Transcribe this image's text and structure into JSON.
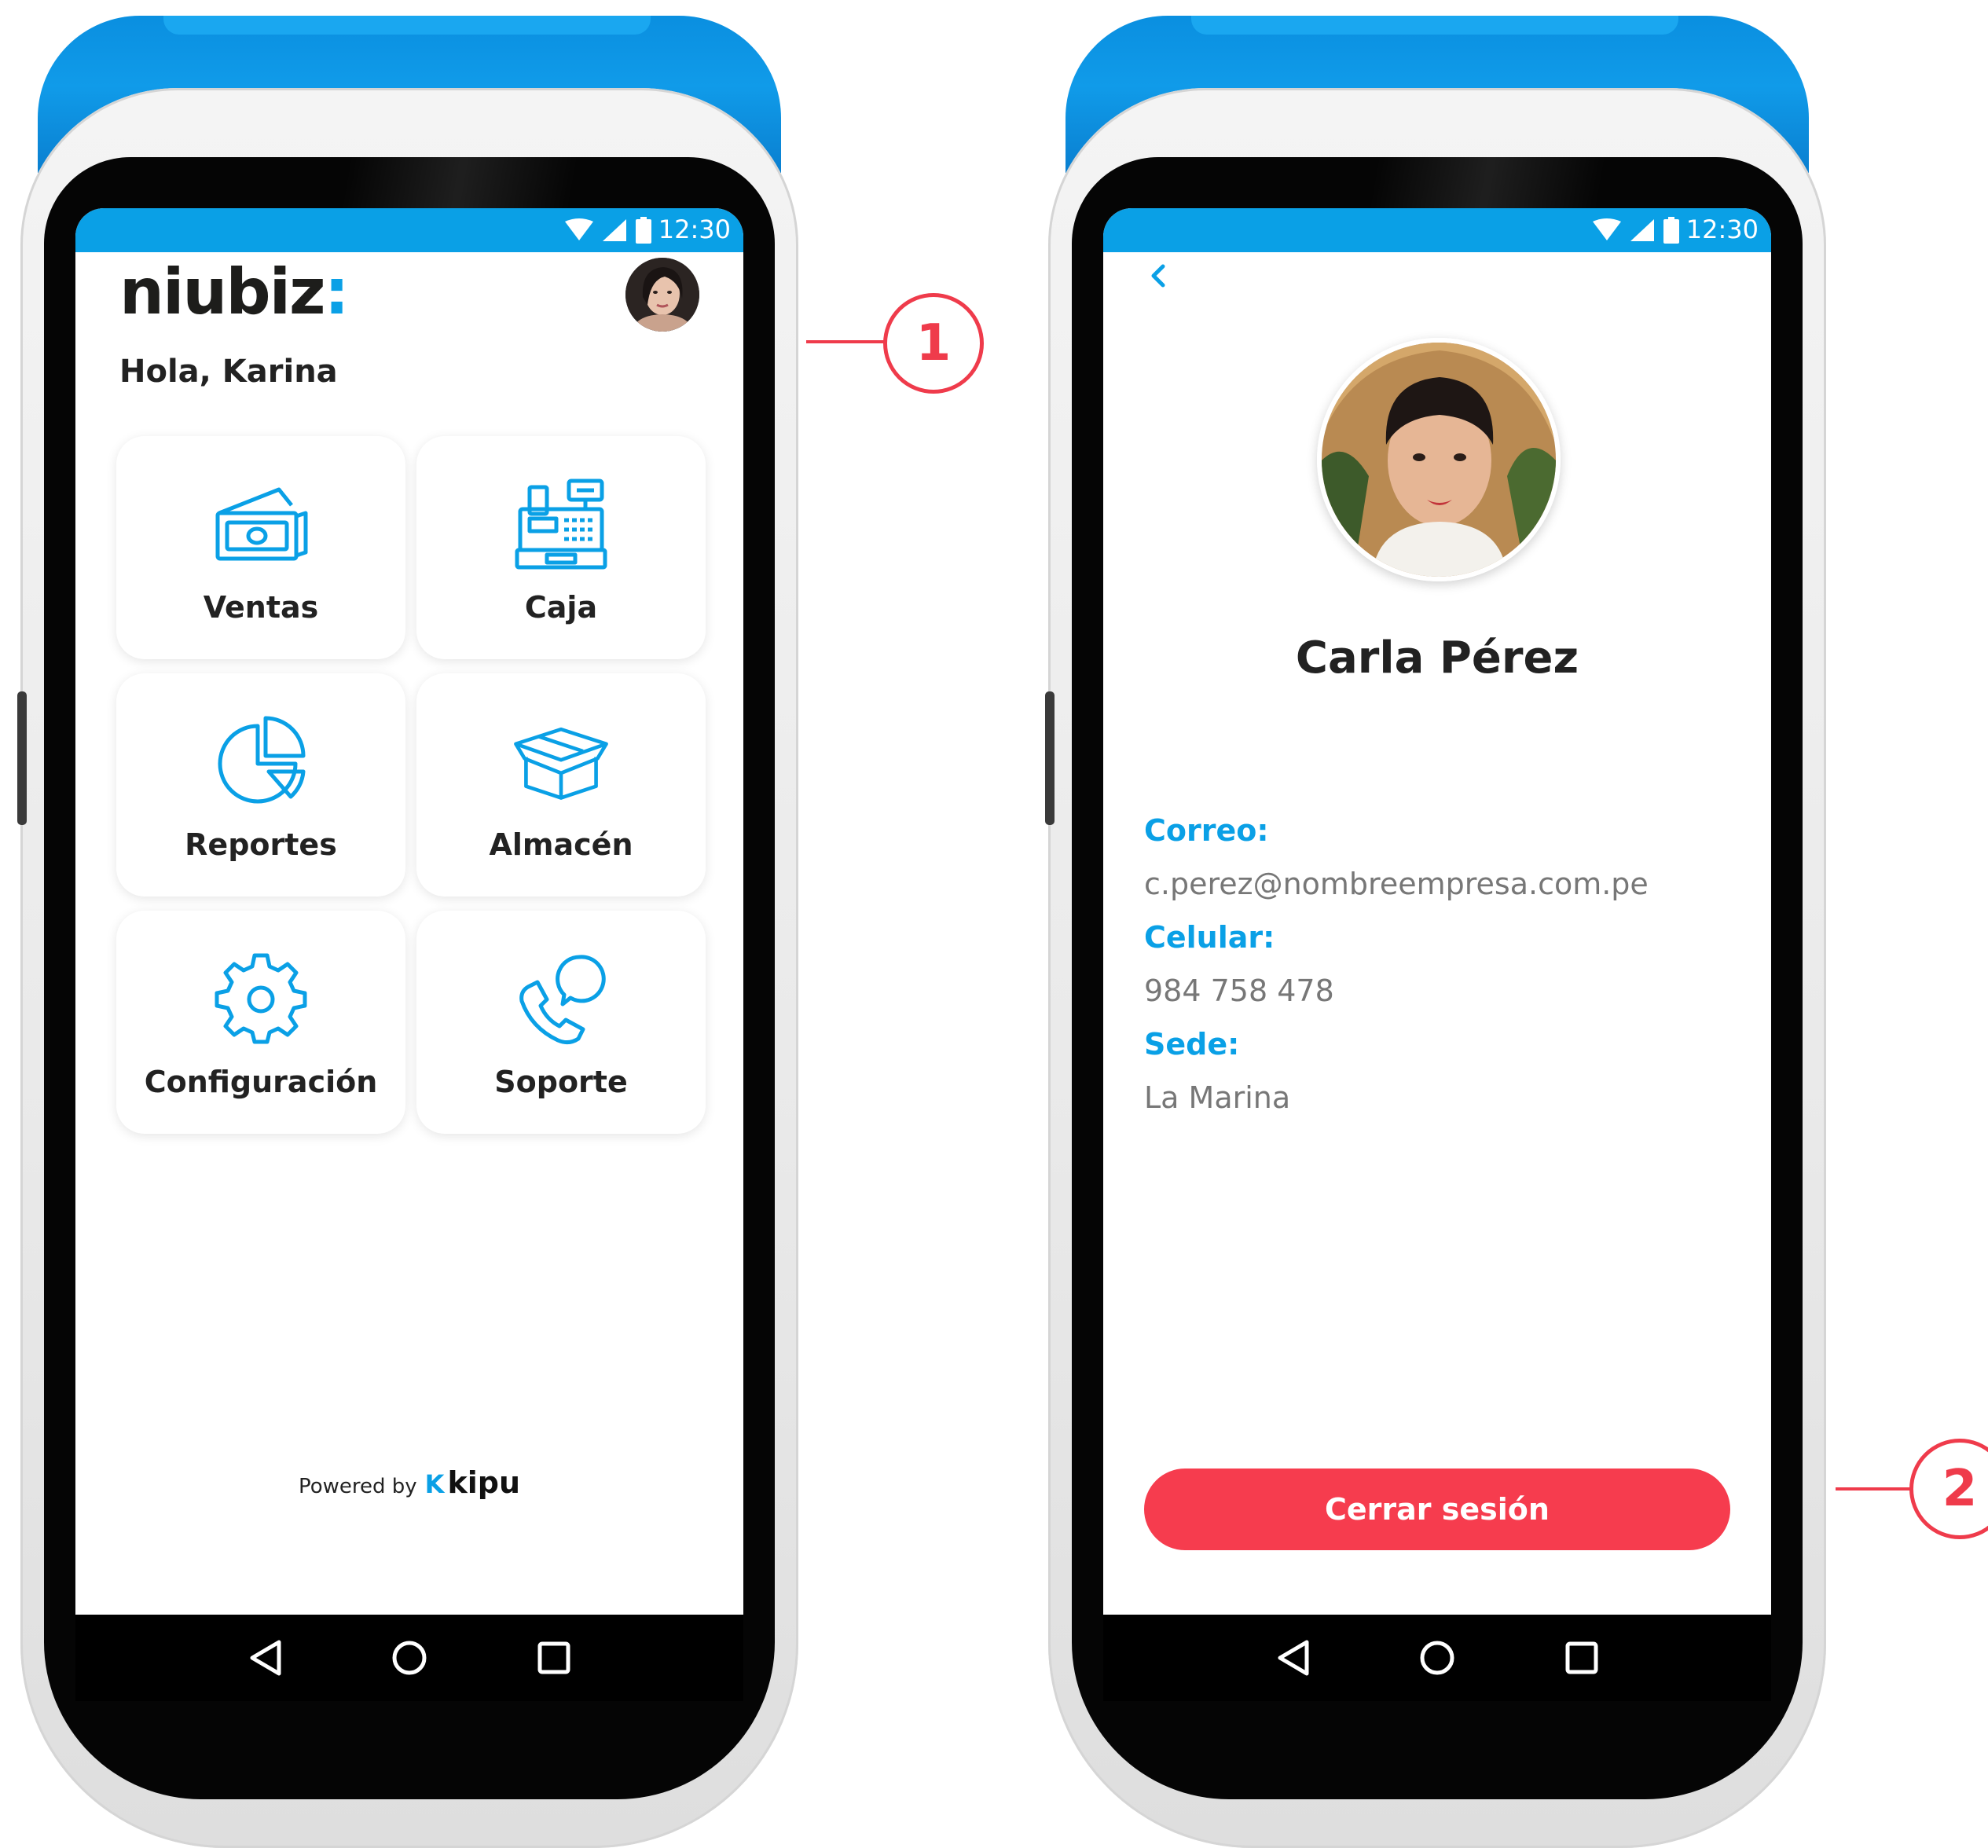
{
  "status_bar": {
    "time": "12:30"
  },
  "home": {
    "brand": {
      "name": "niubiz",
      "colon": ":"
    },
    "greeting": "Hola, Karina",
    "tiles": [
      {
        "label": "Ventas",
        "icon": "cash-icon"
      },
      {
        "label": "Caja",
        "icon": "cash-register-icon"
      },
      {
        "label": "Reportes",
        "icon": "pie-chart-icon"
      },
      {
        "label": "Almacén",
        "icon": "box-icon"
      },
      {
        "label": "Configuración",
        "icon": "gear-icon"
      },
      {
        "label": "Soporte",
        "icon": "phone-chat-icon"
      }
    ],
    "powered_by": {
      "prefix": "Powered by",
      "brand": "kipu"
    }
  },
  "profile": {
    "name": "Carla Pérez",
    "fields": [
      {
        "label": "Correo:",
        "value": "c.perez@nombreempresa.com.pe"
      },
      {
        "label": "Celular:",
        "value": "984 758 478"
      },
      {
        "label": "Sede:",
        "value": "La Marina"
      }
    ],
    "logout_label": "Cerrar sesión"
  },
  "callouts": [
    "1",
    "2"
  ],
  "colors": {
    "accent": "#0aa0e6",
    "logout": "#f63c4e",
    "callout": "#ef3b4b"
  }
}
